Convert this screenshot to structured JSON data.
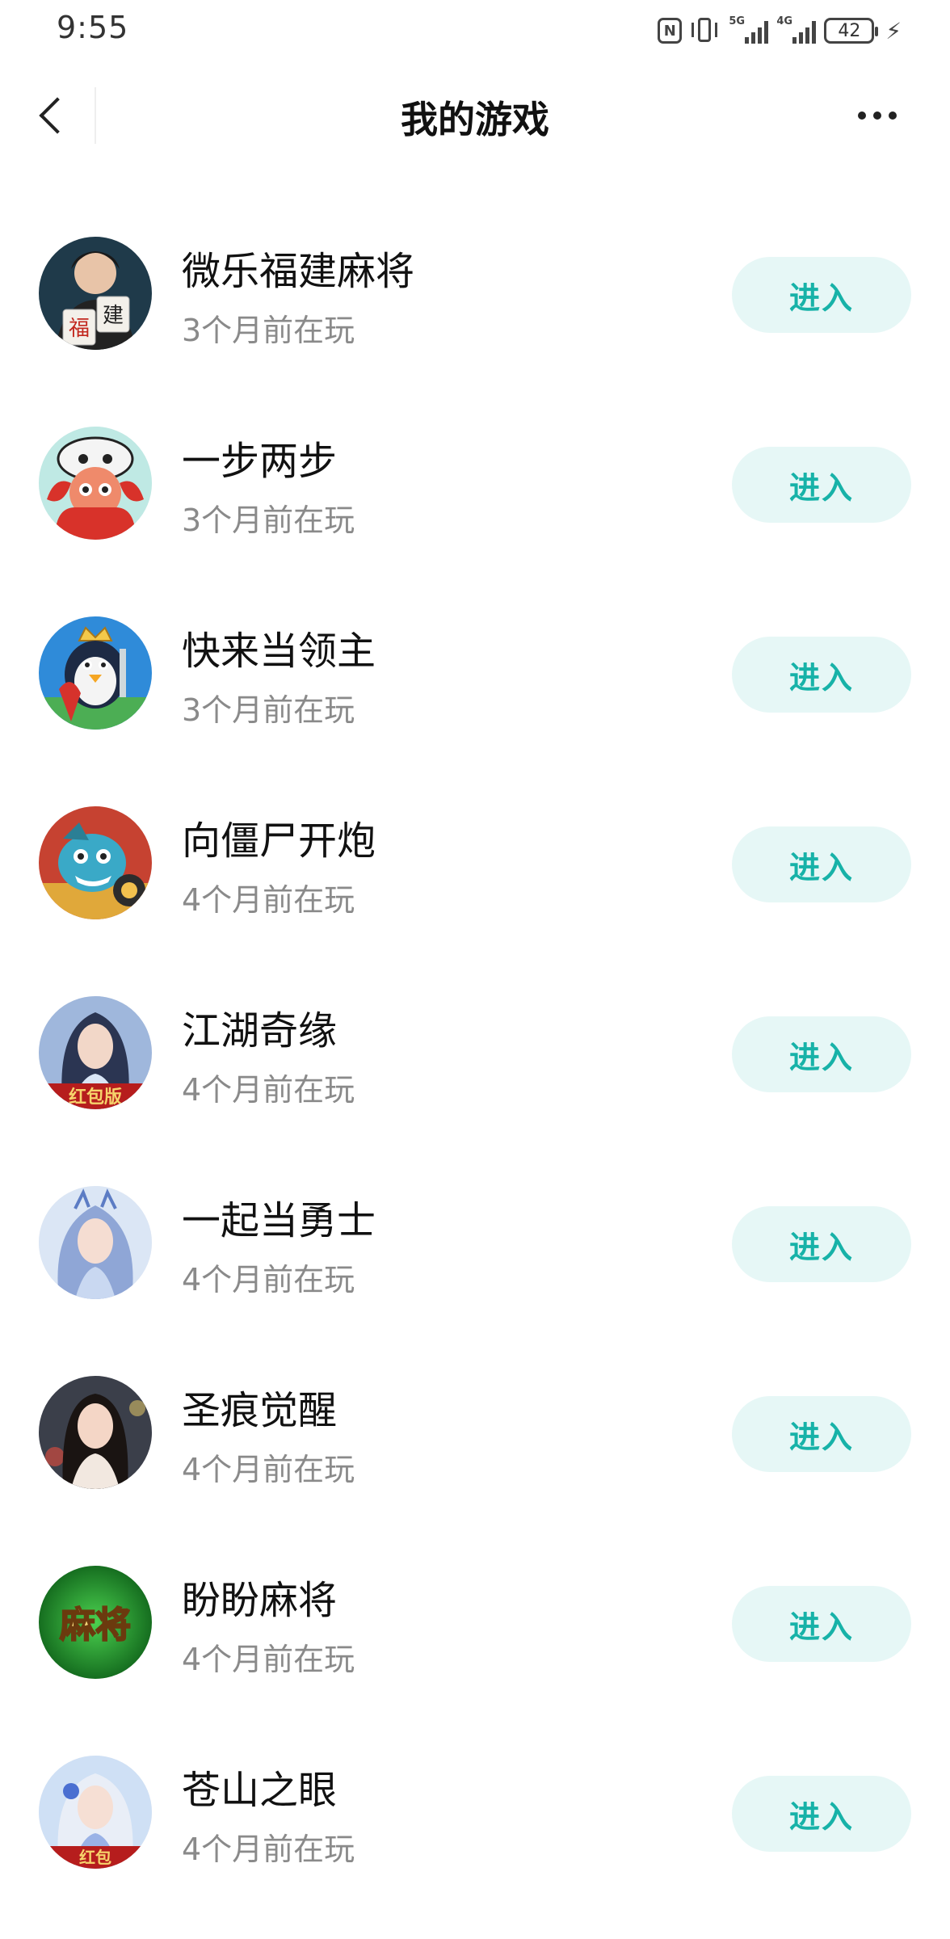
{
  "status_bar": {
    "time": "9:55",
    "nfc": "N",
    "signal_5g": "5G",
    "signal_4g": "4G",
    "battery": "42"
  },
  "header": {
    "title": "我的游戏"
  },
  "games": [
    {
      "name": "微乐福建麻将",
      "time": "3个月前在玩",
      "button": "进入",
      "icon": "mahjong-fujian-icon"
    },
    {
      "name": "一步两步",
      "time": "3个月前在玩",
      "button": "进入",
      "icon": "cartoon-dragon-icon"
    },
    {
      "name": "快来当领主",
      "time": "3个月前在玩",
      "button": "进入",
      "icon": "penguin-king-icon"
    },
    {
      "name": "向僵尸开炮",
      "time": "4个月前在玩",
      "button": "进入",
      "icon": "zombie-cannon-icon"
    },
    {
      "name": "江湖奇缘",
      "time": "4个月前在玩",
      "button": "进入",
      "icon": "wuxia-heroine-icon"
    },
    {
      "name": "一起当勇士",
      "time": "4个月前在玩",
      "button": "进入",
      "icon": "fantasy-heroine-icon"
    },
    {
      "name": "圣痕觉醒",
      "time": "4个月前在玩",
      "button": "进入",
      "icon": "portrait-woman-icon"
    },
    {
      "name": "盼盼麻将",
      "time": "4个月前在玩",
      "button": "进入",
      "icon": "mahjong-green-icon"
    },
    {
      "name": "苍山之眼",
      "time": "4个月前在玩",
      "button": "进入",
      "icon": "silver-hair-heroine-icon"
    }
  ],
  "icon_badges": {
    "fujian_tile_1": "福",
    "fujian_tile_2": "建",
    "redpacket_version": "红包版",
    "redpacket": "红包",
    "mahjong_text": "麻将"
  },
  "colors": {
    "accent": "#17b2a8",
    "button_bg": "#e6f7f6",
    "secondary_text": "#8a8a8a"
  }
}
